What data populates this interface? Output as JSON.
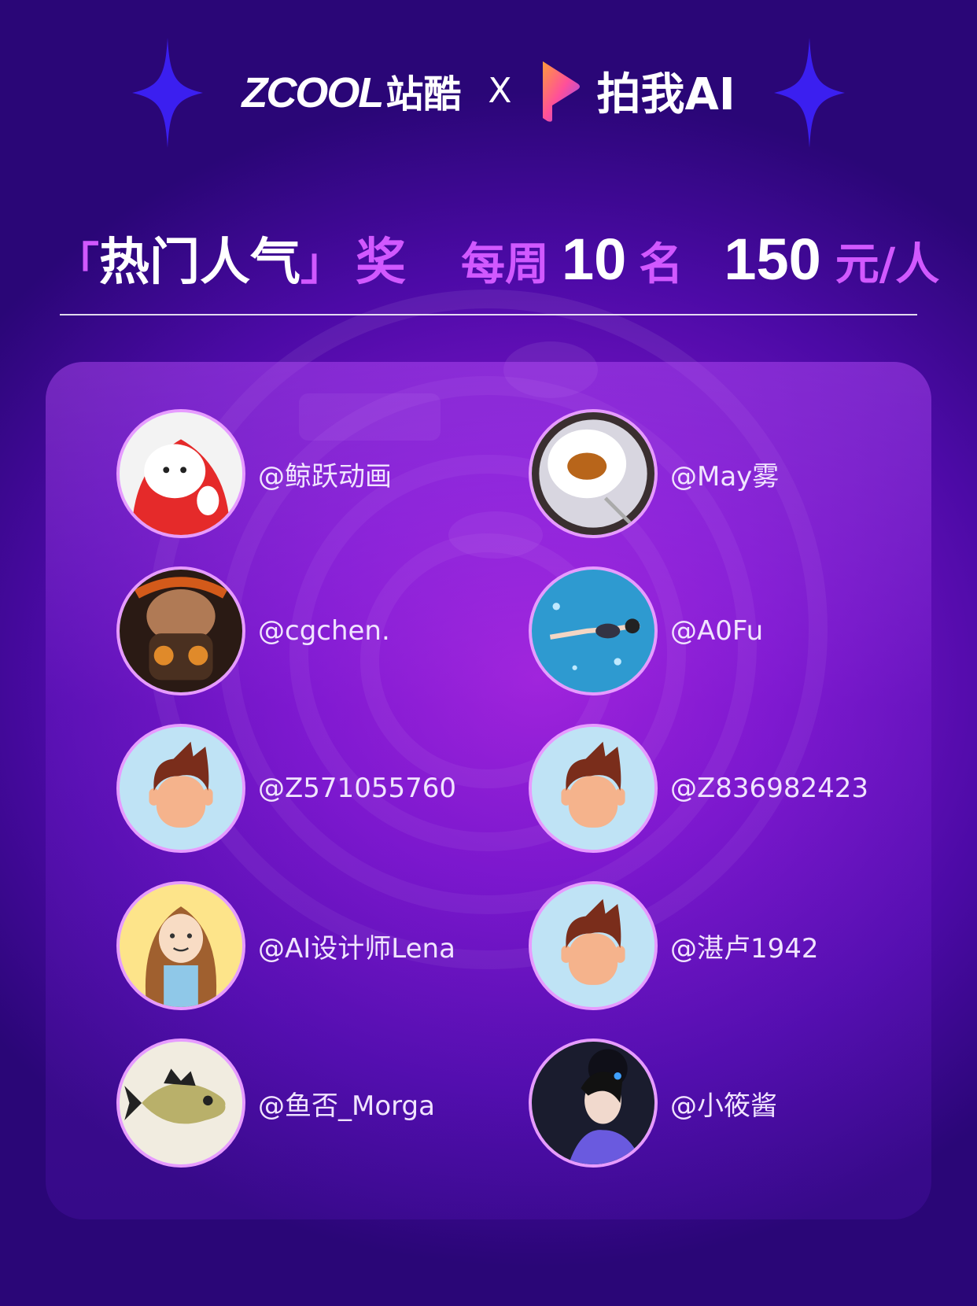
{
  "header": {
    "brand1": "ZCOOL",
    "brand1_cn": "站酷",
    "separator": "X",
    "brand2": "拍我AI"
  },
  "title": {
    "bracket_open": "「",
    "name": "热门人气",
    "bracket_close": "」",
    "award": "奖",
    "weekly": "每周",
    "count": "10",
    "count_unit": "名",
    "amount": "150",
    "amount_unit": "元/人"
  },
  "winners": [
    {
      "handle": "@鲸跃动画",
      "avatar": "red-hood-character-avatar"
    },
    {
      "handle": "@May雾",
      "avatar": "teacup-avatar"
    },
    {
      "handle": "@cgchen.",
      "avatar": "armored-face-avatar"
    },
    {
      "handle": "@A0Fu",
      "avatar": "swimmer-avatar"
    },
    {
      "handle": "@Z571055760",
      "avatar": "default-user-avatar"
    },
    {
      "handle": "@Z836982423",
      "avatar": "default-user-avatar"
    },
    {
      "handle": "@AI设计师Lena",
      "avatar": "cartoon-girl-avatar"
    },
    {
      "handle": "@湛卢1942",
      "avatar": "default-user-avatar"
    },
    {
      "handle": "@鱼否_Morga",
      "avatar": "fish-avatar"
    },
    {
      "handle": "@小筱酱",
      "avatar": "hanfu-woman-avatar"
    }
  ]
}
